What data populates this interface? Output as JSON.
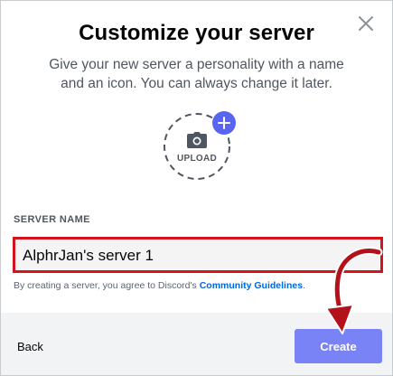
{
  "dialog": {
    "title": "Customize your server",
    "subtitle": "Give your new server a personality with a name and an icon. You can always change it later.",
    "close_icon": "close-icon"
  },
  "upload": {
    "label": "UPLOAD",
    "camera_icon": "camera-icon",
    "add_icon": "plus-icon"
  },
  "server_name": {
    "label": "SERVER NAME",
    "value": "AlphrJan's server 1"
  },
  "terms": {
    "prefix": "By creating a server, you agree to Discord's",
    "link": "Community Guidelines",
    "suffix": "."
  },
  "footer": {
    "back_label": "Back",
    "create_label": "Create"
  },
  "colors": {
    "accent": "#5865f2",
    "create_button": "#7983f5",
    "highlight": "#d4141c",
    "link": "#0068e0"
  }
}
